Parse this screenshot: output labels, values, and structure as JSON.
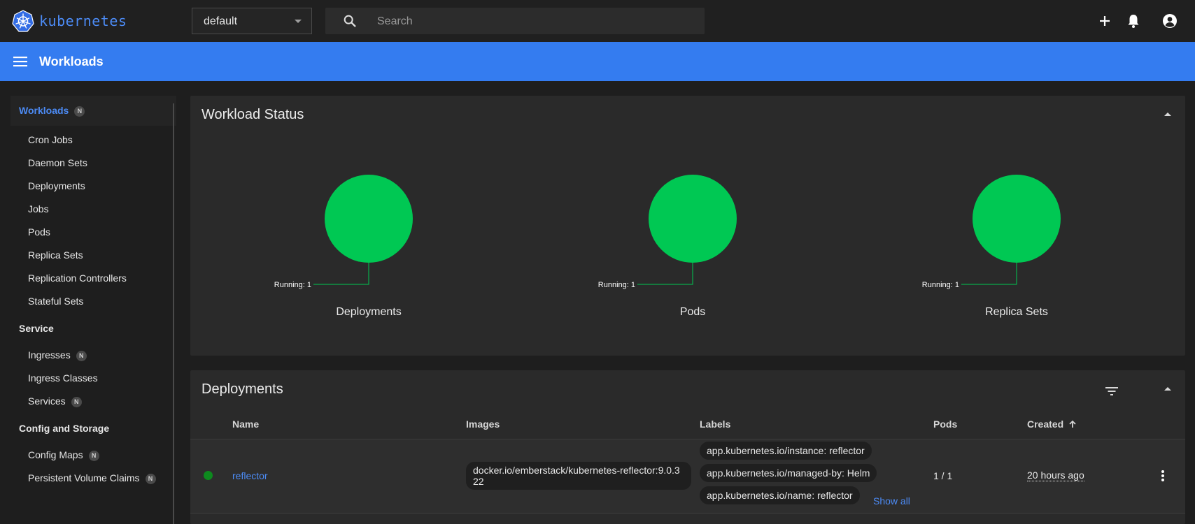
{
  "topbar": {
    "brand": "kubernetes",
    "namespace": "default",
    "search_placeholder": "Search"
  },
  "header": {
    "title": "Workloads"
  },
  "sidebar": {
    "workloads": {
      "label": "Workloads",
      "badge": "N"
    },
    "workload_items": [
      "Cron Jobs",
      "Daemon Sets",
      "Deployments",
      "Jobs",
      "Pods",
      "Replica Sets",
      "Replication Controllers",
      "Stateful Sets"
    ],
    "service": {
      "label": "Service"
    },
    "service_items": [
      {
        "label": "Ingresses",
        "badge": "N"
      },
      {
        "label": "Ingress Classes",
        "badge": ""
      },
      {
        "label": "Services",
        "badge": "N"
      }
    ],
    "config": {
      "label": "Config and Storage"
    },
    "config_items": [
      {
        "label": "Config Maps",
        "badge": "N"
      },
      {
        "label": "Persistent Volume Claims",
        "badge": "N"
      }
    ]
  },
  "workload_status": {
    "title": "Workload Status",
    "charts": [
      {
        "name": "Deployments",
        "legend": "Running: 1",
        "running": 1
      },
      {
        "name": "Pods",
        "legend": "Running: 1",
        "running": 1
      },
      {
        "name": "Replica Sets",
        "legend": "Running: 1",
        "running": 1
      }
    ],
    "running_color": "#00c853"
  },
  "deployments": {
    "title": "Deployments",
    "columns": {
      "name": "Name",
      "images": "Images",
      "labels": "Labels",
      "pods": "Pods",
      "created": "Created"
    },
    "row": {
      "name": "reflector",
      "image": "docker.io/emberstack/kubernetes-reflector:9.0.322",
      "labels": [
        "app.kubernetes.io/instance: reflector",
        "app.kubernetes.io/managed-by: Helm",
        "app.kubernetes.io/name: reflector"
      ],
      "show_all": "Show all",
      "pods": "1 / 1",
      "created": "20 hours ago",
      "status_color": "#0d8a1e"
    }
  }
}
